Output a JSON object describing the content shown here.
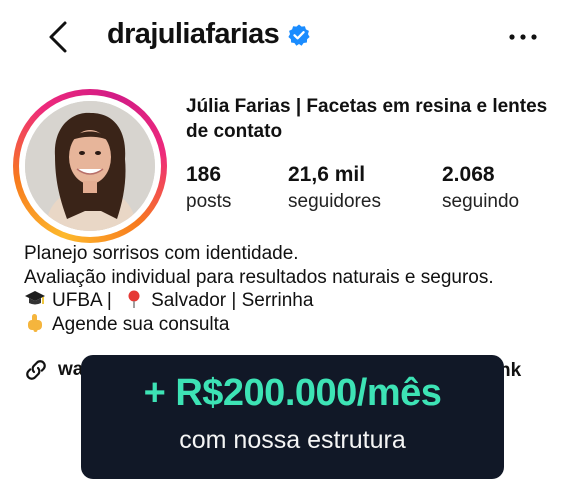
{
  "header": {
    "username": "drajuliafarias",
    "back_icon": "chevron-left-icon",
    "verified_icon": "verified-badge-icon",
    "more_icon": "more-horizontal-icon"
  },
  "profile": {
    "display_name": "Júlia Farias | Facetas em resina e lentes de contato",
    "stats": [
      {
        "value": "186",
        "label": "posts"
      },
      {
        "value": "21,6 mil",
        "label": "seguidores"
      },
      {
        "value": "2.068",
        "label": "seguindo"
      }
    ],
    "bio": {
      "line1": "Planejo sorrisos com identidade.",
      "line2": "Avaliação individual para resultados naturais e seguros.",
      "line3_a": "UFBA |",
      "line3_b": "Salvador | Serrinha",
      "line4": "Agende sua consulta"
    },
    "link": {
      "visible_prefix": "wa",
      "visible_suffix": "nk",
      "icon": "link-icon"
    }
  },
  "promo": {
    "amount": "+ R$200.000/mês",
    "subtitle": "com nossa estrutura"
  },
  "colors": {
    "accent_green": "#3de3b5",
    "promo_bg": "#111827",
    "verified_blue": "#1a8cff"
  }
}
